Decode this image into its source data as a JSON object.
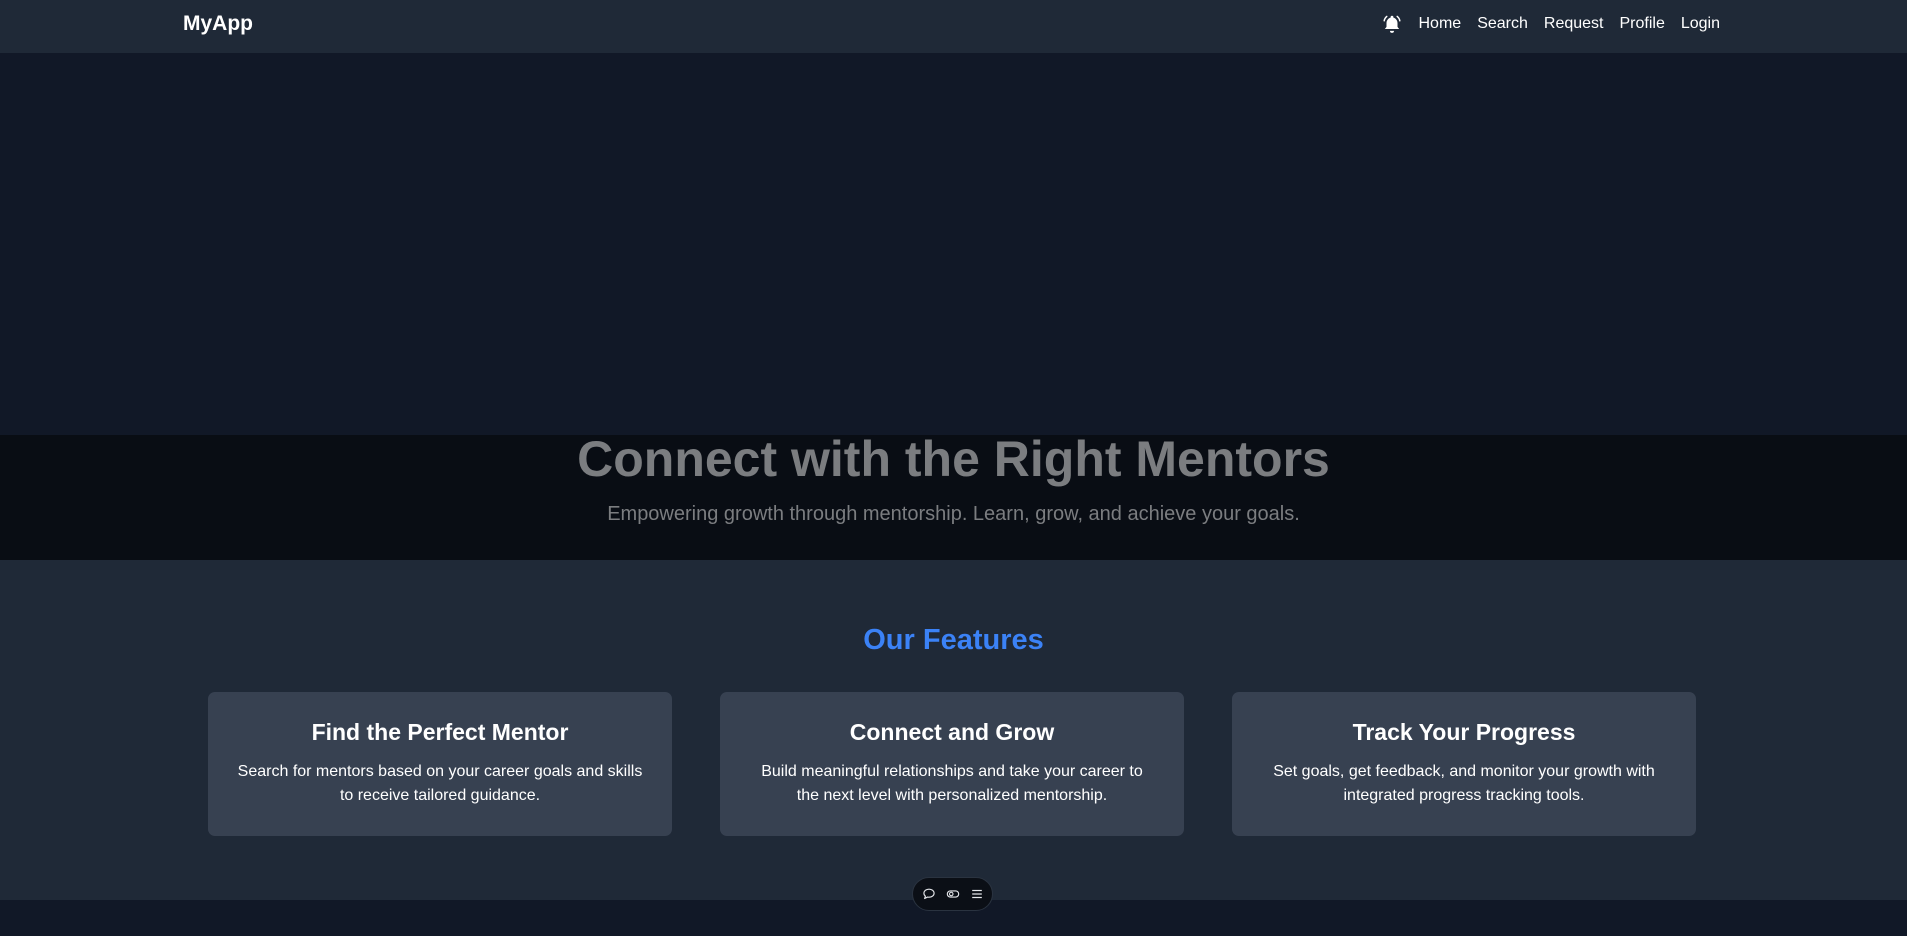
{
  "navbar": {
    "brand": "MyApp",
    "notification_icon": "bell-icon",
    "links": [
      "Home",
      "Search",
      "Request",
      "Profile",
      "Login"
    ]
  },
  "hero": {
    "title": "Connect with the Right Mentors",
    "subtitle": "Empowering growth through mentorship. Learn, grow, and achieve your goals."
  },
  "features": {
    "title": "Our Features",
    "cards": [
      {
        "title": "Find the Perfect Mentor",
        "description": "Search for mentors based on your career goals and skills to receive tailored guidance."
      },
      {
        "title": "Connect and Grow",
        "description": "Build meaningful relationships and take your career to the next level with personalized mentorship."
      },
      {
        "title": "Track Your Progress",
        "description": "Set goals, get feedback, and monitor your growth with integrated progress tracking tools."
      }
    ]
  },
  "floating_toolbar": {
    "icons": [
      "chat-bubble-icon",
      "toggle-icon",
      "menu-icon"
    ]
  },
  "colors": {
    "page_bg": "#111827",
    "navbar_bg": "#1f2937",
    "card_bg": "#374151",
    "accent": "#3b82f6",
    "hero_text": "#7b7d80"
  }
}
